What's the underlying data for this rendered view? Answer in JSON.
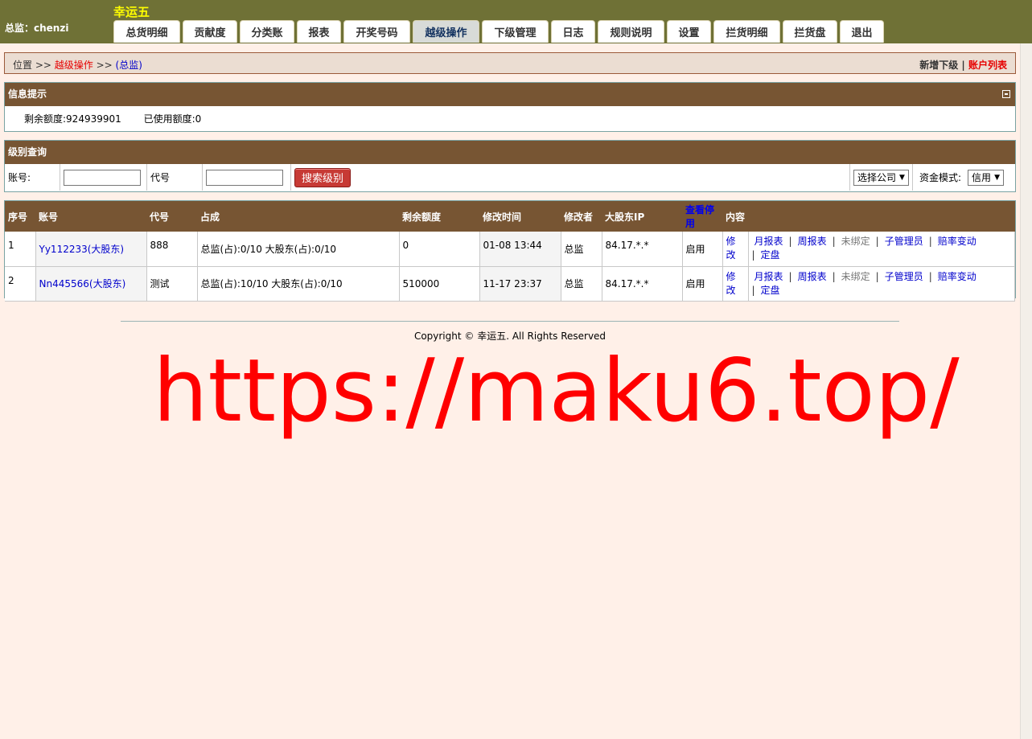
{
  "header": {
    "user_label": "总监：chenzi",
    "brand": "幸运五",
    "tabs": [
      "总货明细",
      "贡献度",
      "分类账",
      "报表",
      "开奖号码",
      "越级操作",
      "下级管理",
      "日志",
      "规则说明",
      "设置",
      "拦货明细",
      "拦货盘",
      "退出"
    ],
    "active_tab": "越级操作"
  },
  "breadcrumb": {
    "prefix": "位置 >> ",
    "current": "越级操作",
    "sep": " >> ",
    "level": "(总监)",
    "action_add": "新增下级",
    "divider": " | ",
    "action_list": "账户列表"
  },
  "info": {
    "title": "信息提示",
    "remaining": "剩余额度:924939901",
    "used": "已使用额度:0"
  },
  "search": {
    "title": "级别查询",
    "account_label": "账号:",
    "code_label": "代号",
    "button": "搜索级别",
    "company_select": "选择公司",
    "fund_mode_label": "资金模式:",
    "fund_mode_value": "信用"
  },
  "table": {
    "headers": {
      "no": "序号",
      "account": "账号",
      "code": "代号",
      "share": "占成",
      "remaining": "剩余额度",
      "modified_time": "修改时间",
      "modifier": "修改者",
      "ip": "大股东IP",
      "view_disabled": "查看停用",
      "content": "内容"
    },
    "rows": [
      {
        "no": "1",
        "account": "Yy112233(大股东)",
        "code": "888",
        "share": "总监(占):0/10 大股东(占):0/10",
        "remaining": "0",
        "modified_time": "01-08 13:44",
        "modifier": "总监",
        "ip": "84.17.*.*",
        "status": "启用",
        "edit": "修改"
      },
      {
        "no": "2",
        "account": "Nn445566(大股东)",
        "code": "测试",
        "share": "总监(占):10/10 大股东(占):0/10",
        "remaining": "510000",
        "modified_time": "11-17 23:37",
        "modifier": "总监",
        "ip": "84.17.*.*",
        "status": "启用",
        "edit": "修改"
      }
    ],
    "ops": {
      "monthly": "月报表",
      "weekly": "周报表",
      "unbound": "未绑定",
      "sub_admin": "子管理员",
      "odds_change": "赔率变动",
      "fixed": "定盘",
      "sep": "|"
    }
  },
  "footer": {
    "copyright": "Copyright © 幸运五. All Rights Reserved",
    "watermark": "https://maku6.top/"
  }
}
